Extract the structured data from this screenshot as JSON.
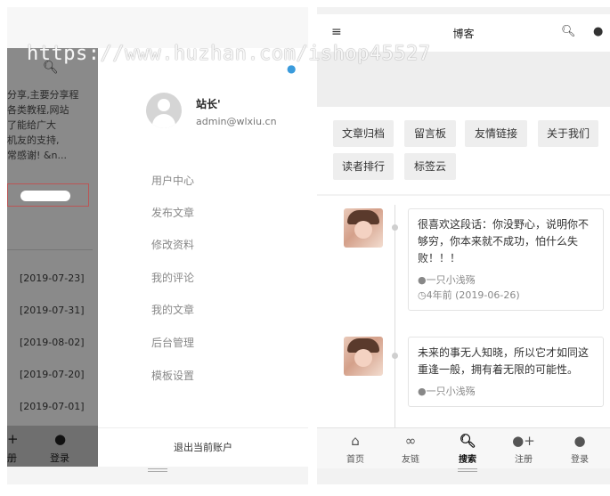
{
  "watermark": "https://www.huzhan.com/ishop45527",
  "left": {
    "background_page": {
      "intro": "分享,主要分享程\n各类教程,网站\n了能给广大\n机友的支持,\n常感谢! &n...",
      "dates": [
        "[2019-07-23]",
        "[2019-07-31]",
        "[2019-08-02]",
        "[2019-07-20]",
        "[2019-07-01]"
      ],
      "bottom_login": "登录",
      "bottom_partial": "册"
    },
    "drawer": {
      "username": "站长'",
      "email": "admin@wlxiu.cn",
      "menu": [
        "用户中心",
        "发布文章",
        "修改资料",
        "我的评论",
        "我的文章",
        "后台管理",
        "模板设置"
      ],
      "logout": "退出当前账户"
    }
  },
  "right": {
    "header": {
      "title": "博客"
    },
    "tags": [
      "文章归档",
      "留言板",
      "友情链接",
      "关于我们",
      "读者排行",
      "标签云"
    ],
    "feed": [
      {
        "quote": "很喜欢这段话：你没野心，说明你不够穷，你本来就不成功，怕什么失败！！！",
        "author": "一只小浅殇",
        "time": "4年前 (2019-06-26)"
      },
      {
        "quote": "未来的事无人知晓，所以它才如同这重逢一般，拥有着无限的可能性。",
        "author": "一只小浅殇",
        "time": ""
      }
    ],
    "bottom_nav": [
      {
        "label": "首页",
        "icon": "home-icon"
      },
      {
        "label": "友链",
        "icon": "link-icon"
      },
      {
        "label": "搜索",
        "icon": "search-icon"
      },
      {
        "label": "注册",
        "icon": "add-user-icon"
      },
      {
        "label": "登录",
        "icon": "user-icon"
      }
    ]
  },
  "colors": {
    "accent_blue": "#3a9bdc",
    "overlay_gray": "#8a8a8a"
  }
}
